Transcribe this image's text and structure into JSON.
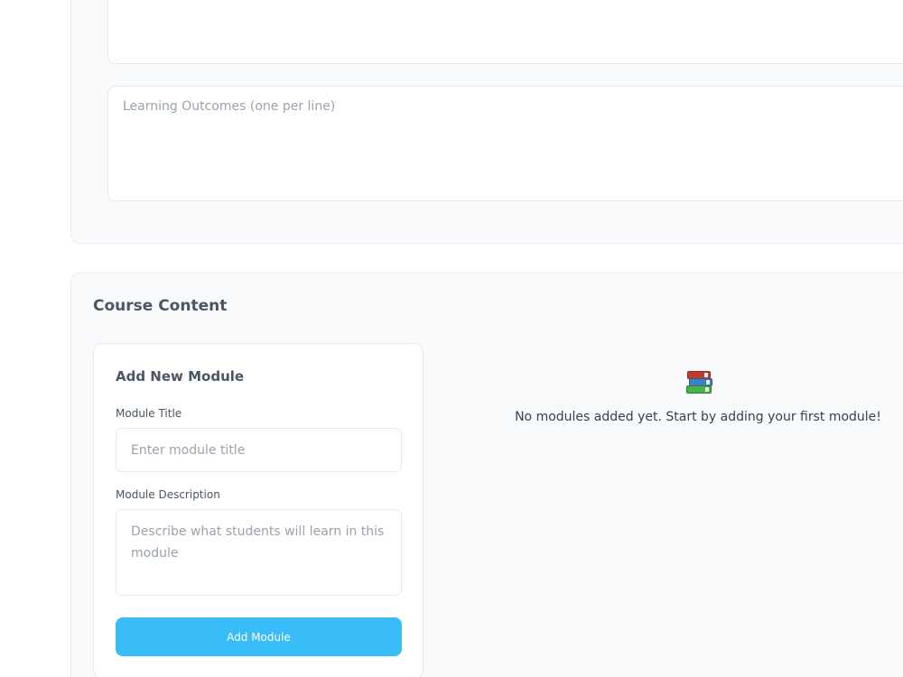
{
  "course_details": {
    "description_placeholder": "",
    "outcomes_placeholder": "Learning Outcomes (one per line)"
  },
  "course_content": {
    "title": "Course Content",
    "add_module": {
      "title": "Add New Module",
      "module_title_label": "Module Title",
      "module_title_placeholder": "Enter module title",
      "module_description_label": "Module Description",
      "module_description_placeholder": "Describe what students will learn in this module",
      "add_button_label": "Add Module"
    },
    "empty_state": {
      "icon": "books-icon",
      "message": "No modules added yet. Start by adding your first module!"
    }
  },
  "colors": {
    "accent": "#38bdf8",
    "card_background": "#f8fafc",
    "border": "#e5e9f0"
  }
}
